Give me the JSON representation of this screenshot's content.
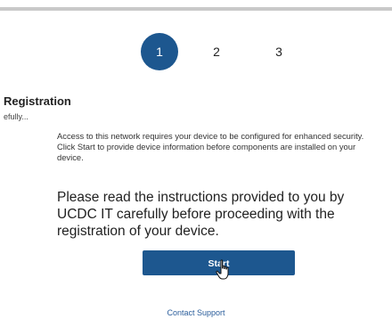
{
  "stepper": {
    "steps": [
      {
        "label": "1",
        "active": true
      },
      {
        "label": "2",
        "active": false
      },
      {
        "label": "3",
        "active": false
      }
    ]
  },
  "registration": {
    "title": "Registration",
    "subtitle": "efully..."
  },
  "body": {
    "access_text": "Access to this network requires your device to be configured for enhanced security. Click Start to provide device information before components are installed on your device.",
    "instructions": "Please read the instructions provided to you by UCDC IT carefully before proceeding with the registration of your device."
  },
  "actions": {
    "start_label": "Start"
  },
  "footer": {
    "contact_label": "Contact Support"
  },
  "colors": {
    "accent": "#1d578f",
    "link": "#2a5d9b"
  },
  "icons": {
    "cursor": "hand-pointer-icon"
  }
}
